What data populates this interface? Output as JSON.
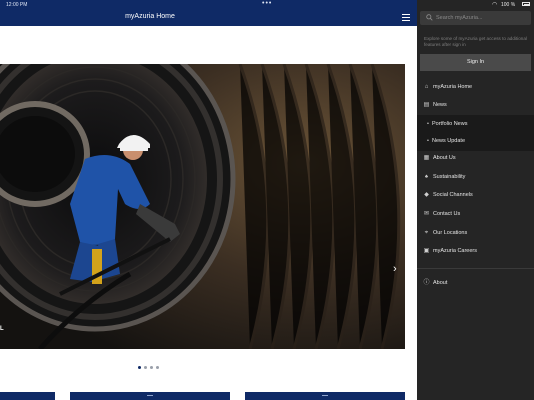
{
  "status_bar": {
    "time": "12:00 PM",
    "more_dots": "•••",
    "battery": "100 %"
  },
  "app_bar": {
    "title": "myAzuria Home"
  },
  "hero": {
    "caption": "L",
    "slide_count": 4,
    "active_slide": 1
  },
  "drawer": {
    "search_placeholder": "Search myAzuria...",
    "signin_notice": "Explore some of myAzuria get access to additional features after sign in",
    "signin_button": "Sign In",
    "menu": [
      {
        "label": "myAzuria Home",
        "icon": "home-icon",
        "type": "main"
      },
      {
        "label": "News",
        "icon": "news-icon",
        "type": "main"
      },
      {
        "label": "Portfolio News",
        "icon": "bullet",
        "type": "sub"
      },
      {
        "label": "News Update",
        "icon": "bullet",
        "type": "sub"
      },
      {
        "label": "About Us",
        "icon": "info-icon",
        "type": "main"
      },
      {
        "label": "Sustainability",
        "icon": "leaf-icon",
        "type": "main"
      },
      {
        "label": "Social Channels",
        "icon": "share-icon",
        "type": "main"
      },
      {
        "label": "Contact Us",
        "icon": "mail-icon",
        "type": "main"
      },
      {
        "label": "Our Locations",
        "icon": "location-icon",
        "type": "main"
      },
      {
        "label": "myAzuria Careers",
        "icon": "briefcase-icon",
        "type": "main"
      },
      {
        "label": "About",
        "icon": "info-circle-icon",
        "type": "main"
      }
    ]
  },
  "colors": {
    "brand_navy": "#0f2a66",
    "drawer_bg": "#252525"
  }
}
